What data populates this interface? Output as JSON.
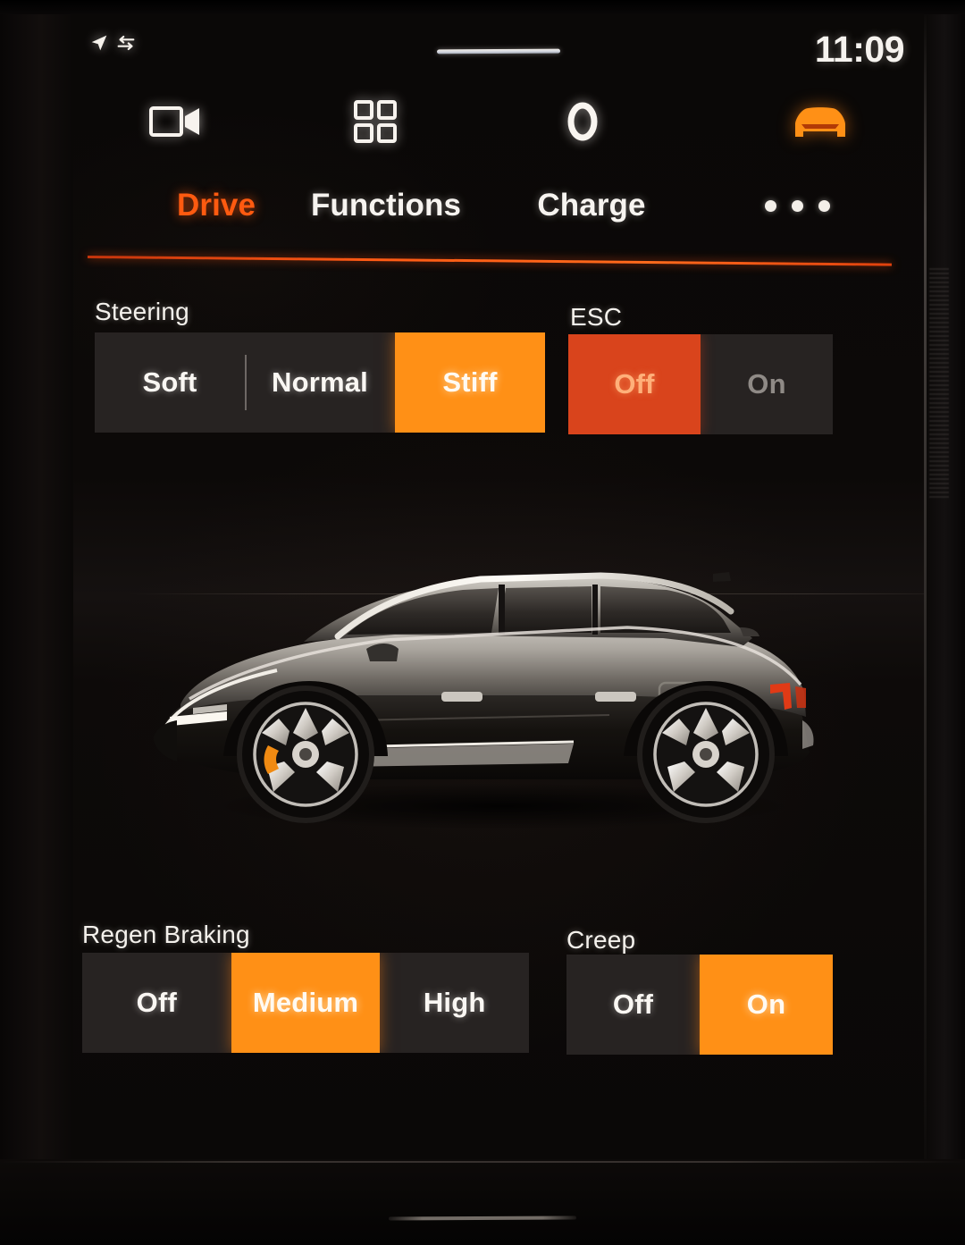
{
  "status_bar": {
    "clock": "11:09",
    "icons": [
      "location-arrow-icon",
      "data-transfer-icon"
    ],
    "handle": "drag-handle"
  },
  "icon_bar": {
    "items": [
      {
        "icon": "camera-icon",
        "label": "Camera",
        "state": "inactive"
      },
      {
        "icon": "apps-grid-icon",
        "label": "Apps",
        "state": "inactive"
      },
      {
        "icon": "climate-ring-icon",
        "label": "Climate",
        "state": "inactive"
      },
      {
        "icon": "car-front-icon",
        "label": "Car",
        "state": "active"
      }
    ]
  },
  "tabs": {
    "items": [
      {
        "label": "Drive",
        "active": true
      },
      {
        "label": "Functions",
        "active": false
      },
      {
        "label": "Charge",
        "active": false
      },
      {
        "label": "more-options",
        "active": false
      }
    ]
  },
  "settings": {
    "steering": {
      "label": "Steering",
      "options": [
        {
          "label": "Soft",
          "selected": false
        },
        {
          "label": "Normal",
          "selected": false
        },
        {
          "label": "Stiff",
          "selected": true
        }
      ],
      "selected_value": "Stiff"
    },
    "esc": {
      "label": "ESC",
      "options": [
        {
          "label": "Off",
          "selected": true
        },
        {
          "label": "On",
          "selected": false
        }
      ],
      "selected_value": "Off"
    },
    "regen_braking": {
      "label": "Regen Braking",
      "options": [
        {
          "label": "Off",
          "selected": false
        },
        {
          "label": "Medium",
          "selected": true
        },
        {
          "label": "High",
          "selected": false
        }
      ],
      "selected_value": "Medium"
    },
    "creep": {
      "label": "Creep",
      "options": [
        {
          "label": "Off",
          "selected": false
        },
        {
          "label": "On",
          "selected": true
        }
      ],
      "selected_value": "On"
    }
  },
  "vehicle_image": {
    "name": "car-side-profile-render",
    "description": "Side profile of dark grey electric fastback sedan"
  },
  "colors": {
    "accent_amber": "#ff9016",
    "accent_orange": "#ff5a10",
    "accent_red": "#d9441c",
    "screen_background": "#0a0807",
    "segment_background": "#272322",
    "text_primary": "#f7f4f0",
    "text_dim": "#8f8a86"
  }
}
